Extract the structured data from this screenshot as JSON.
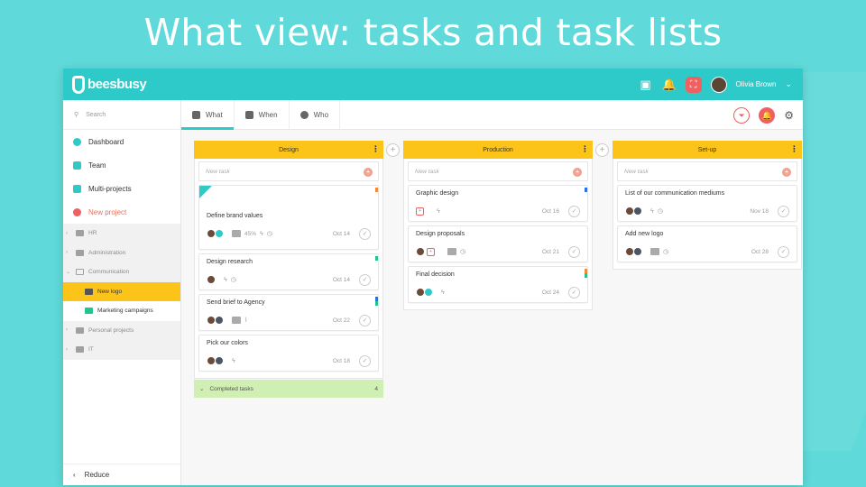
{
  "headline": "What view: tasks and task lists",
  "topbar": {
    "logo_text": "beesbusy",
    "user_name": "Olivia Brown",
    "icons": [
      "chat-icon",
      "bell-icon",
      "fullscreen-icon",
      "avatar",
      "chevron-down-icon"
    ]
  },
  "sidebar": {
    "search_placeholder": "Search",
    "nav": [
      {
        "label": "Dashboard",
        "icon": "dashboard-icon"
      },
      {
        "label": "Team",
        "icon": "team-icon"
      },
      {
        "label": "Multi-projects",
        "icon": "multiprojects-icon"
      },
      {
        "label": "New project",
        "icon": "add-icon"
      }
    ],
    "projects": [
      {
        "label": "HR"
      },
      {
        "label": "Administration"
      },
      {
        "label": "Communication"
      },
      {
        "label": "New logo"
      },
      {
        "label": "Marketing campaigns"
      },
      {
        "label": "Personal projects"
      },
      {
        "label": "IT"
      }
    ],
    "reduce_label": "Reduce"
  },
  "tabs": [
    {
      "label": "What"
    },
    {
      "label": "When"
    },
    {
      "label": "Who"
    }
  ],
  "columns": [
    {
      "title": "Design",
      "new_task": "New task",
      "cards": [
        {
          "title": "Define brand values",
          "percent": "45%",
          "date": "Oct 14"
        },
        {
          "title": "Design research",
          "date": "Oct 14"
        },
        {
          "title": "Send brief to Agency",
          "date": "Oct 22"
        },
        {
          "title": "Pick our colors",
          "date": "Oct 18"
        }
      ],
      "completed_label": "Completed tasks",
      "completed_count": "4"
    },
    {
      "title": "Production",
      "new_task": "New task",
      "cards": [
        {
          "title": "Graphic design",
          "date": "Oct 16"
        },
        {
          "title": "Design proposals",
          "date": "Oct 21"
        },
        {
          "title": "Final decision",
          "date": "Oct 24"
        }
      ]
    },
    {
      "title": "Set-up",
      "new_task": "New task",
      "cards": [
        {
          "title": "List of our communication mediums",
          "date": "Nov 18"
        },
        {
          "title": "Add new logo",
          "date": "Oct 28"
        }
      ]
    }
  ],
  "colors": {
    "teal": "#2ec9c9",
    "yellow": "#fcc419",
    "red": "#f06060",
    "green": "#cfefb3"
  }
}
